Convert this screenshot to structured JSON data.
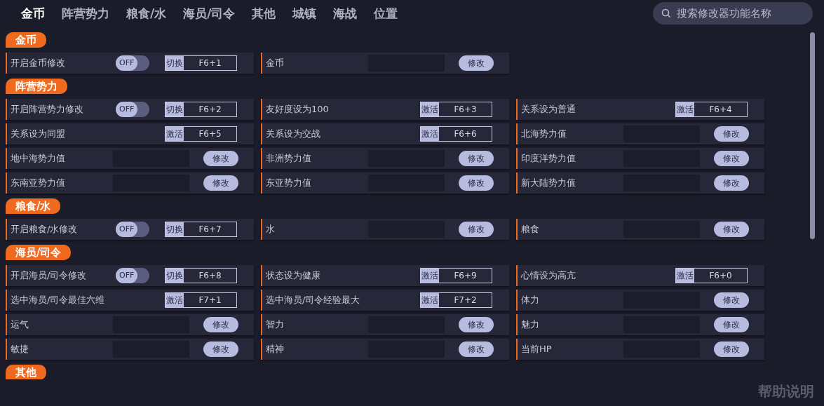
{
  "tabs": [
    {
      "label": "金币",
      "selected": true
    },
    {
      "label": "阵营势力",
      "selected": false
    },
    {
      "label": "粮食/水",
      "selected": false
    },
    {
      "label": "海员/司令",
      "selected": false
    },
    {
      "label": "其他",
      "selected": false
    },
    {
      "label": "城镇",
      "selected": false
    },
    {
      "label": "海战",
      "selected": false
    },
    {
      "label": "位置",
      "selected": false
    }
  ],
  "search": {
    "placeholder": "搜索修改器功能名称"
  },
  "sections": [
    {
      "title": "金币",
      "items": [
        {
          "kind": "toggle",
          "label": "开启金币修改",
          "on": false,
          "switch_text": "OFF",
          "action": "切换",
          "key": "F6+1"
        },
        {
          "kind": "input",
          "label": "金币",
          "button": "修改"
        }
      ]
    },
    {
      "title": "阵营势力",
      "items": [
        {
          "kind": "toggle",
          "label": "开启阵营势力修改",
          "on": false,
          "switch_text": "OFF",
          "action": "切换",
          "key": "F6+2"
        },
        {
          "kind": "hotkey",
          "label": "友好度设为100",
          "action": "激活",
          "key": "F6+3"
        },
        {
          "kind": "hotkey",
          "label": "关系设为普通",
          "action": "激活",
          "key": "F6+4"
        },
        {
          "kind": "hotkey",
          "label": "关系设为同盟",
          "action": "激活",
          "key": "F6+5"
        },
        {
          "kind": "hotkey",
          "label": "关系设为交战",
          "action": "激活",
          "key": "F6+6"
        },
        {
          "kind": "input",
          "label": "北海势力值",
          "button": "修改"
        },
        {
          "kind": "input",
          "label": "地中海势力值",
          "button": "修改"
        },
        {
          "kind": "input",
          "label": "非洲势力值",
          "button": "修改"
        },
        {
          "kind": "input",
          "label": "印度洋势力值",
          "button": "修改"
        },
        {
          "kind": "input",
          "label": "东南亚势力值",
          "button": "修改"
        },
        {
          "kind": "input",
          "label": "东亚势力值",
          "button": "修改"
        },
        {
          "kind": "input",
          "label": "新大陆势力值",
          "button": "修改"
        }
      ]
    },
    {
      "title": "粮食/水",
      "items": [
        {
          "kind": "toggle",
          "label": "开启粮食/水修改",
          "on": false,
          "switch_text": "OFF",
          "action": "切换",
          "key": "F6+7"
        },
        {
          "kind": "input",
          "label": "水",
          "button": "修改"
        },
        {
          "kind": "input",
          "label": "粮食",
          "button": "修改"
        }
      ]
    },
    {
      "title": "海员/司令",
      "items": [
        {
          "kind": "toggle",
          "label": "开启海员/司令修改",
          "on": false,
          "switch_text": "OFF",
          "action": "切换",
          "key": "F6+8"
        },
        {
          "kind": "hotkey",
          "label": "状态设为健康",
          "action": "激活",
          "key": "F6+9"
        },
        {
          "kind": "hotkey",
          "label": "心情设为高亢",
          "action": "激活",
          "key": "F6+0"
        },
        {
          "kind": "hotkey",
          "label": "选中海员/司令最佳六维",
          "action": "激活",
          "key": "F7+1"
        },
        {
          "kind": "hotkey",
          "label": "选中海员/司令经验最大",
          "action": "激活",
          "key": "F7+2"
        },
        {
          "kind": "input",
          "label": "体力",
          "button": "修改"
        },
        {
          "kind": "input",
          "label": "运气",
          "button": "修改"
        },
        {
          "kind": "input",
          "label": "智力",
          "button": "修改"
        },
        {
          "kind": "input",
          "label": "魅力",
          "button": "修改"
        },
        {
          "kind": "input",
          "label": "敏捷",
          "button": "修改"
        },
        {
          "kind": "input",
          "label": "精神",
          "button": "修改"
        },
        {
          "kind": "input",
          "label": "当前HP",
          "button": "修改"
        }
      ]
    },
    {
      "title": "其他"
    }
  ],
  "help": "帮助说明"
}
